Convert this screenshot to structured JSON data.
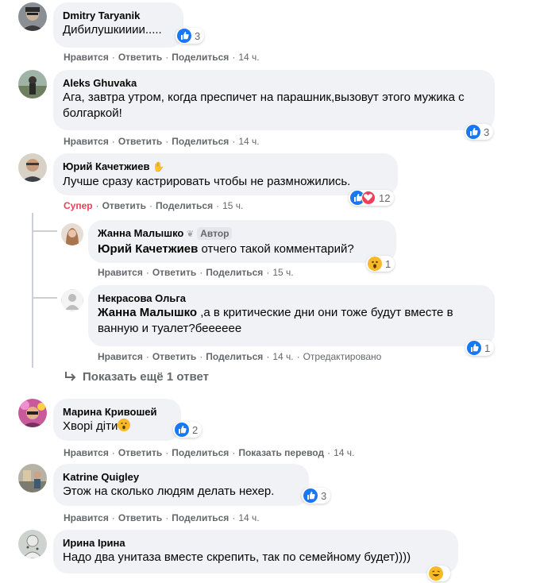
{
  "actions": {
    "like": "Нравится",
    "reply": "Ответить",
    "share": "Поделиться",
    "super": "Супер",
    "translate": "Показать перевод",
    "edited": "Отредактировано",
    "sep": "·"
  },
  "author_badge": "Автор",
  "more_replies": "Показать ещё 1 ответ",
  "comments": [
    {
      "author": "Dmitry Taryanik",
      "text": "Дибилушкииии.....",
      "reactions": "3",
      "time": "14 ч."
    },
    {
      "author": "Aleks Ghuvaka",
      "text": "Ага, завтра утром, когда преспичет на парашник,вызовут этого мужика с болгаркой!",
      "reactions": "3",
      "time": "14 ч."
    },
    {
      "author": "Юрий Качетжиев",
      "text": "Лучше сразу кастрировать чтобы не размножились.",
      "reactions": "12",
      "time": "15 ч."
    },
    {
      "author": "Жанна Малышко",
      "mention": "Юрий Качетжиев",
      "text": "отчего такой комментарий?",
      "reactions": "1",
      "time": "15 ч."
    },
    {
      "author": "Некрасова Ольга",
      "mention": "Жанна Малышко",
      "text": ",а в критические дни они тоже будут вместе в ванную и туалет?беееееe",
      "reactions": "1",
      "time": "14 ч."
    },
    {
      "author": "Марина Кривошей",
      "text": "Хворі діти",
      "reactions": "2",
      "time": "14 ч."
    },
    {
      "author": "Katrine Quigley",
      "text": "Этож на сколько людям делать нехер.",
      "reactions": "3",
      "time": "14 ч."
    },
    {
      "author": "Ирина Ірина",
      "text": "Надо два унитаза вместе скрепить, так по семейному будет))))",
      "reactions": "",
      "time": ""
    }
  ],
  "colors": {
    "bubble": "#f0f2f5",
    "meta": "#65676b",
    "like_blue": "#1877f2",
    "love_red": "#f33e58",
    "wow_yellow": "#f7b928"
  }
}
